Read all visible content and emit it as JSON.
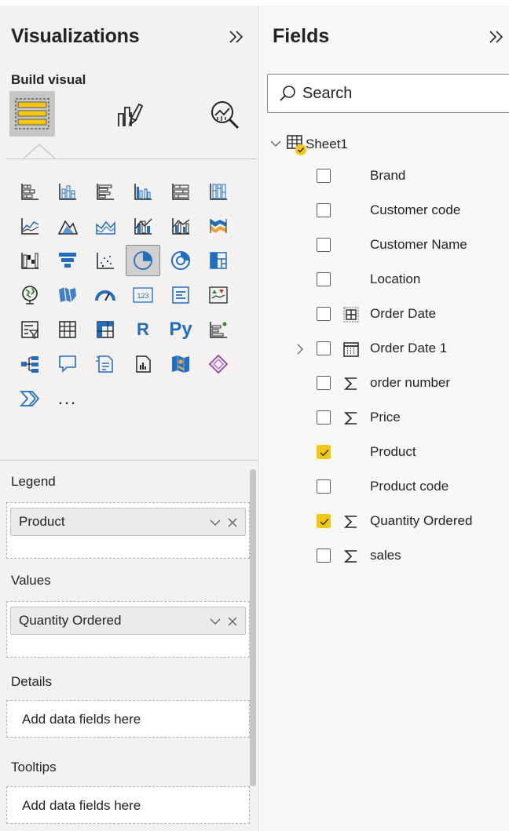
{
  "visualizations": {
    "title": "Visualizations",
    "build_label": "Build visual",
    "more_label": "..."
  },
  "wells": {
    "legend": {
      "label": "Legend",
      "field": "Product"
    },
    "values": {
      "label": "Values",
      "field": "Quantity Ordered"
    },
    "details": {
      "label": "Details",
      "placeholder": "Add data fields here"
    },
    "tooltips": {
      "label": "Tooltips",
      "placeholder": "Add data fields here"
    }
  },
  "fields": {
    "title": "Fields",
    "search_placeholder": "Search",
    "table_name": "Sheet1",
    "items": [
      {
        "label": "Brand",
        "checked": false,
        "type": "text"
      },
      {
        "label": "Customer code",
        "checked": false,
        "type": "text"
      },
      {
        "label": "Customer Name",
        "checked": false,
        "type": "text"
      },
      {
        "label": "Location",
        "checked": false,
        "type": "text"
      },
      {
        "label": "Order Date",
        "checked": false,
        "type": "date"
      },
      {
        "label": "Order Date 1",
        "checked": false,
        "type": "calendar"
      },
      {
        "label": "order number",
        "checked": false,
        "type": "sum"
      },
      {
        "label": "Price",
        "checked": false,
        "type": "sum"
      },
      {
        "label": "Product",
        "checked": true,
        "type": "text"
      },
      {
        "label": "Product code",
        "checked": false,
        "type": "text"
      },
      {
        "label": "Quantity Ordered",
        "checked": true,
        "type": "sum"
      },
      {
        "label": "sales",
        "checked": false,
        "type": "sum"
      }
    ]
  },
  "colors": {
    "accent_yellow": "#f2c811",
    "pane_bg": "#f3f2f1",
    "visual_blue": "#1f6ebf"
  }
}
